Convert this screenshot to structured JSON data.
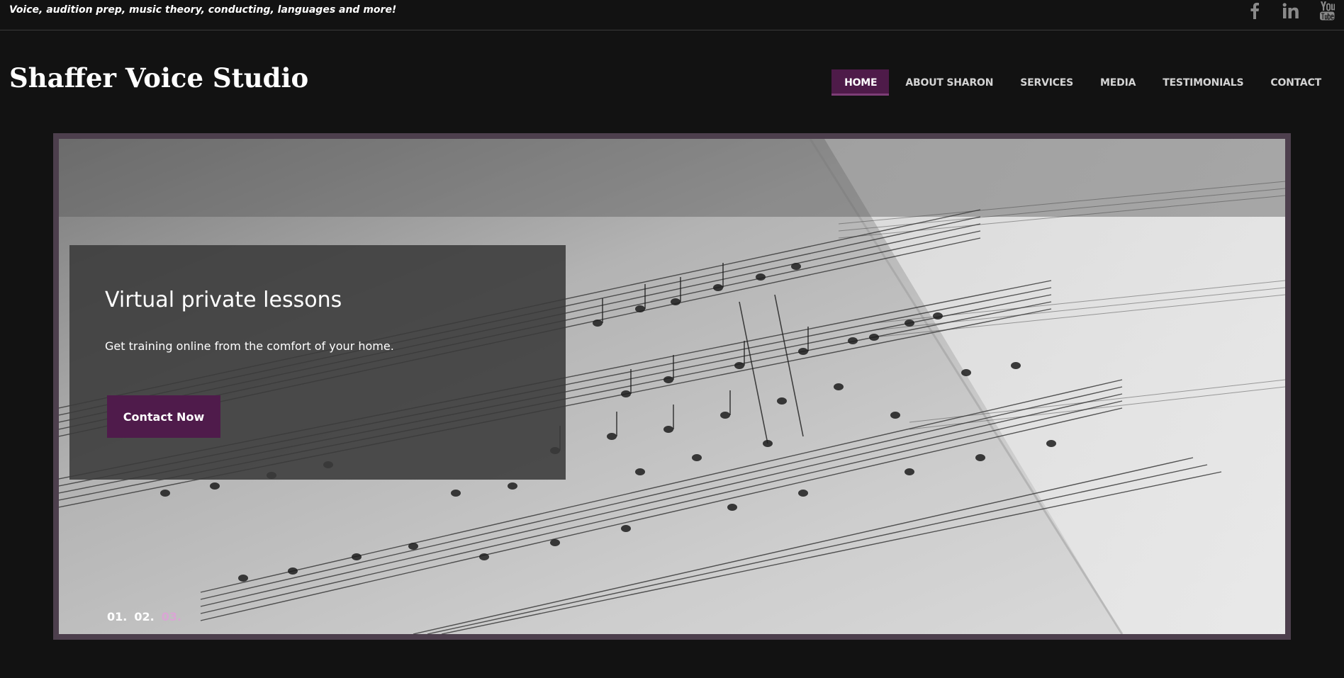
{
  "topbar": {
    "tagline": "Voice, audition prep, music theory, conducting, languages and more!",
    "social": [
      {
        "icon": "facebook-icon"
      },
      {
        "icon": "linkedin-icon"
      },
      {
        "icon": "youtube-icon"
      }
    ]
  },
  "header": {
    "brand": "Shaffer Voice Studio",
    "nav": [
      {
        "label": "HOME",
        "active": true
      },
      {
        "label": "ABOUT SHARON"
      },
      {
        "label": "SERVICES"
      },
      {
        "label": "MEDIA"
      },
      {
        "label": "TESTIMONIALS"
      },
      {
        "label": "CONTACT"
      }
    ]
  },
  "hero": {
    "title": "Virtual private lessons",
    "text": "Get training online from the comfort of your home.",
    "button": "Contact Now",
    "background": "sheet-music-image",
    "pager": [
      "01.",
      "02.",
      "03."
    ],
    "active_slide": 3
  },
  "colors": {
    "background": "#121212",
    "accent": "#4f1b4b",
    "frame": "#4d3f4d",
    "pager_active": "#d9a6d4",
    "icon_gray": "#8a8a8a"
  }
}
